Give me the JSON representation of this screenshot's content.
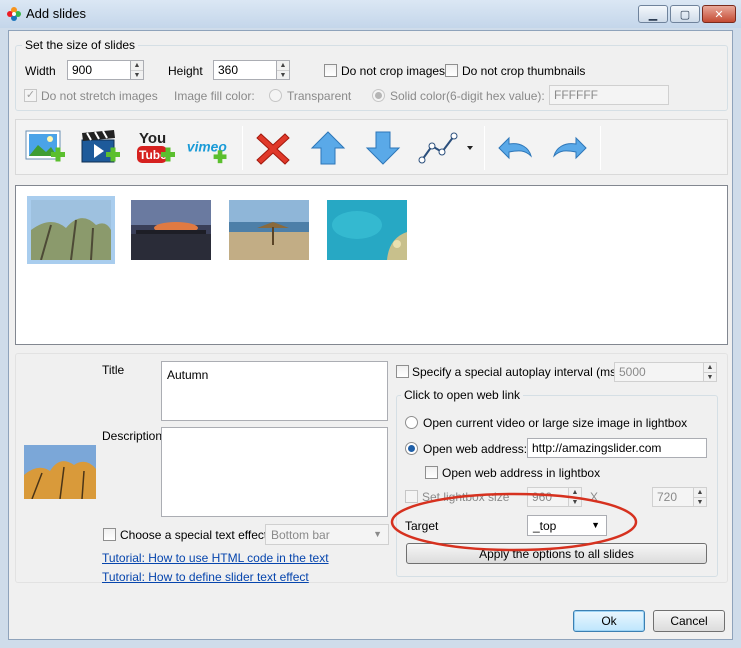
{
  "window": {
    "title": "Add slides"
  },
  "size_group": {
    "legend": "Set the size of slides",
    "width_label": "Width",
    "width_value": "900",
    "height_label": "Height",
    "height_value": "360",
    "no_crop_images": "Do not crop images",
    "no_crop_thumbnails": "Do not crop thumbnails",
    "no_stretch": "Do not stretch images",
    "fill_color_label": "Image fill color:",
    "transparent": "Transparent",
    "solid_color": "Solid color(6-digit hex value):",
    "hex_value": "FFFFFF"
  },
  "toolbar": {
    "youtube_text": "You",
    "youtube_tube": "Tube",
    "vimeo_text": "vimeo"
  },
  "details": {
    "title_label": "Title",
    "title_value": "Autumn",
    "description_label": "Description",
    "description_value": "",
    "text_effect_label": "Choose a special text effect",
    "text_effect_value": "Bottom bar",
    "tutorial_html": "Tutorial: How to use HTML code in the text",
    "tutorial_effect": "Tutorial: How to define slider text effect"
  },
  "link_options": {
    "autoplay_label": "Specify a special autoplay interval (ms):",
    "autoplay_value": "5000",
    "group_legend": "Click to open web link",
    "open_lightbox": "Open current video or large size image in lightbox",
    "open_web_label": "Open web address:",
    "web_address": "http://amazingslider.com",
    "open_web_lightbox": "Open web address in lightbox",
    "set_lightbox_size": "Set lightbox size",
    "lightbox_w": "960",
    "x_label": "X",
    "lightbox_h": "720",
    "target_label": "Target",
    "target_value": "_top",
    "apply_all": "Apply the options to all slides"
  },
  "footer": {
    "ok": "Ok",
    "cancel": "Cancel"
  },
  "colors": {
    "highlight_ellipse": "#d6311f",
    "selection": "#a9cdee",
    "link": "#0645ad"
  }
}
